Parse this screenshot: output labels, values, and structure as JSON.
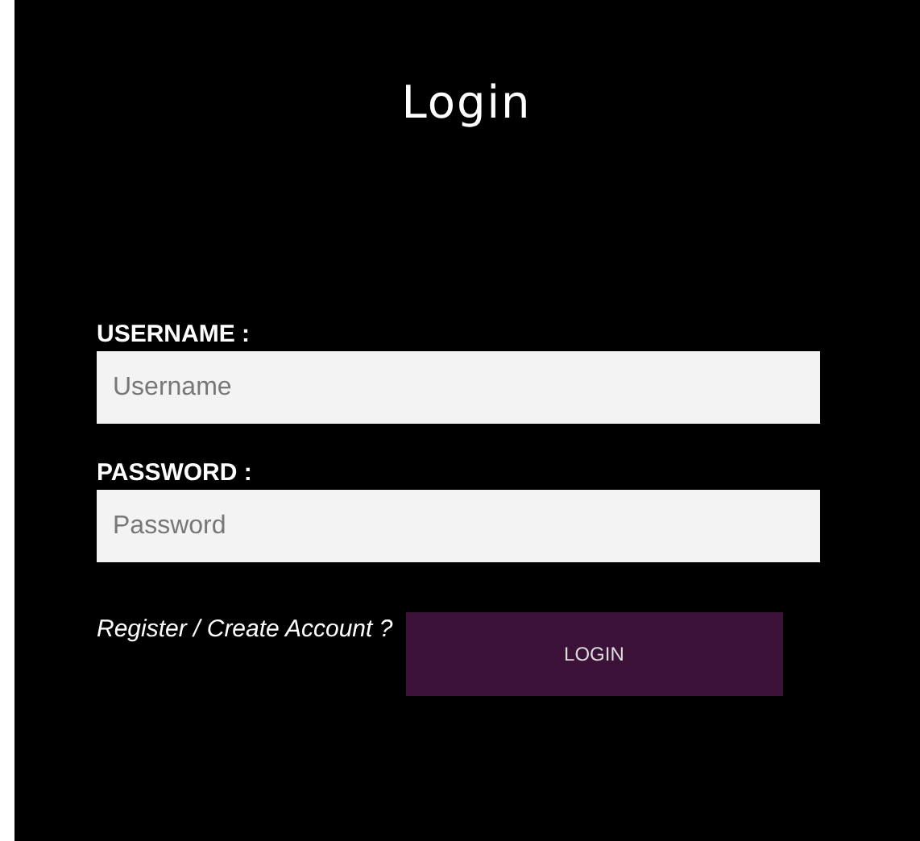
{
  "title": "Login",
  "fields": [
    {
      "label": "USERNAME :",
      "placeholder": "Username"
    },
    {
      "label": "PASSWORD :",
      "placeholder": "Password"
    }
  ],
  "register_link": "Register / Create Account ?",
  "login_button": "LOGIN"
}
